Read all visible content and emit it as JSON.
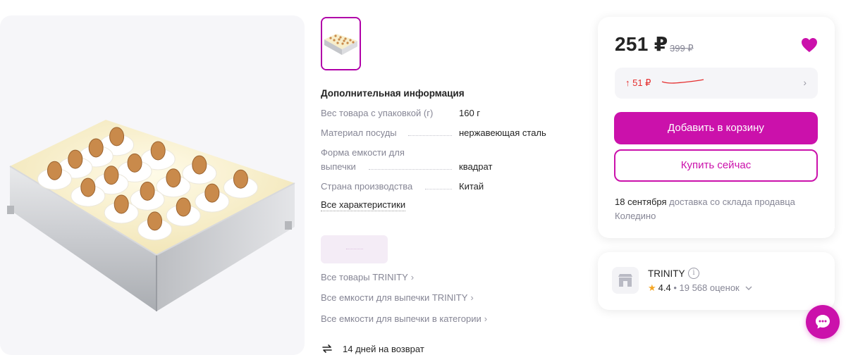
{
  "gallery": {
    "main_image_alt": "product-photo-cake-ring",
    "thumbnail_alt": "thumbnail-cake-ring"
  },
  "specs": {
    "title": "Дополнительная информация",
    "rows": [
      {
        "key": "Вес товара с упаковкой (г)",
        "value": "160 г"
      },
      {
        "key": "Материал посуды",
        "value": "нержавеющая сталь"
      },
      {
        "key_line1": "Форма емкости для",
        "key_line2": "выпечки",
        "value": "квадрат"
      },
      {
        "key": "Страна производства",
        "value": "Китай"
      }
    ],
    "all_link": "Все характеристики"
  },
  "links": {
    "brand_all": "Все товары TRINITY",
    "brand_category": "Все емкости для выпечки TRINITY",
    "category_all": "Все емкости для выпечки в категории"
  },
  "return_policy": "14 дней на возврат",
  "price": {
    "current": "251 ₽",
    "old": "399 ₽",
    "discount": "↑ 51 ₽",
    "add_to_cart": "Добавить в корзину",
    "buy_now": "Купить сейчас",
    "delivery_date": "18 сентября",
    "delivery_text": " доставка со склада продавца Коледино"
  },
  "seller": {
    "name": "TRINITY",
    "rating": "4.4",
    "reviews": " • 19 568 оценок"
  },
  "colors": {
    "accent": "#cb11ab",
    "discount_red": "#e52e2e",
    "muted_text": "#868695",
    "star": "#f5a623"
  },
  "icons": [
    "heart-icon",
    "chevron-right-icon",
    "info-icon",
    "star-icon",
    "chevron-down-icon",
    "return-arrows-icon",
    "store-icon",
    "chat-icon"
  ]
}
